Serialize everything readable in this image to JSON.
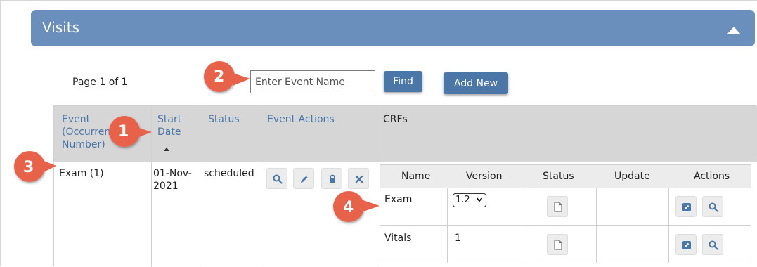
{
  "panel": {
    "title": "Visits"
  },
  "pager": {
    "text": "Page 1 of 1"
  },
  "search": {
    "placeholder": "Enter Event Name",
    "value": ""
  },
  "buttons": {
    "find": "Find",
    "add_new": "Add New"
  },
  "events_table": {
    "headers": {
      "event_line1": "Event",
      "event_line2": "(Occurrence",
      "event_line3": "Number)",
      "start_date_line1": "Start",
      "start_date_line2": "Date",
      "status": "Status",
      "event_actions": "Event Actions",
      "crfs": "CRFs"
    },
    "rows": [
      {
        "event": "Exam (1)",
        "start_date_line1": "01-Nov-",
        "start_date_line2": "2021",
        "status": "scheduled"
      }
    ]
  },
  "crf_table": {
    "headers": [
      "Name",
      "Version",
      "Status",
      "Update",
      "Actions"
    ],
    "rows": [
      {
        "name": "Exam",
        "version": "1.2"
      },
      {
        "name": "Vitals",
        "version": "1"
      }
    ]
  },
  "callouts": [
    "1",
    "2",
    "3",
    "4"
  ],
  "icons": {
    "collapse": "caret-up-icon",
    "view": "magnifier-icon",
    "edit": "pencil-icon",
    "lock": "lock-icon",
    "remove": "x-icon",
    "document": "document-icon",
    "sort": "sort-ascending-icon"
  },
  "colors": {
    "header_bg": "#6a8fbd",
    "button_bg": "#4a76a8",
    "link": "#4a76a8",
    "callout": "#e8624a"
  }
}
